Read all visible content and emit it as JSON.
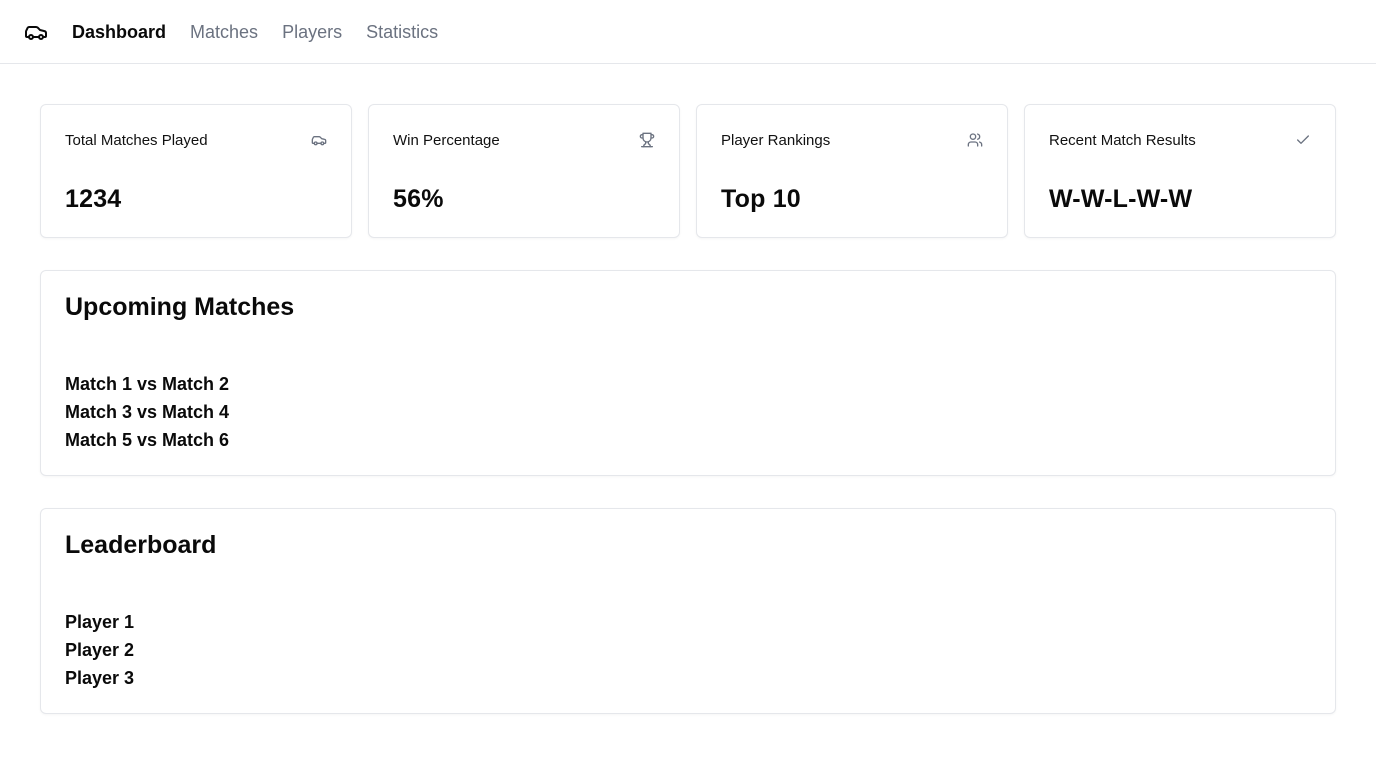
{
  "nav": {
    "logo_icon": "car-icon",
    "items": [
      {
        "label": "Dashboard",
        "active": true
      },
      {
        "label": "Matches",
        "active": false
      },
      {
        "label": "Players",
        "active": false
      },
      {
        "label": "Statistics",
        "active": false
      }
    ]
  },
  "stats": [
    {
      "title": "Total Matches Played",
      "value": "1234",
      "icon": "car-icon"
    },
    {
      "title": "Win Percentage",
      "value": "56%",
      "icon": "trophy-icon"
    },
    {
      "title": "Player Rankings",
      "value": "Top 10",
      "icon": "users-icon"
    },
    {
      "title": "Recent Match Results",
      "value": "W-W-L-W-W",
      "icon": "check-icon"
    }
  ],
  "upcoming": {
    "title": "Upcoming Matches",
    "items": [
      "Match 1 vs Match 2",
      "Match 3 vs Match 4",
      "Match 5 vs Match 6"
    ]
  },
  "leaderboard": {
    "title": "Leaderboard",
    "items": [
      "Player 1",
      "Player 2",
      "Player 3"
    ]
  },
  "colors": {
    "text": "#0a0a0a",
    "muted": "#6b7280",
    "border": "#e5e7eb"
  }
}
